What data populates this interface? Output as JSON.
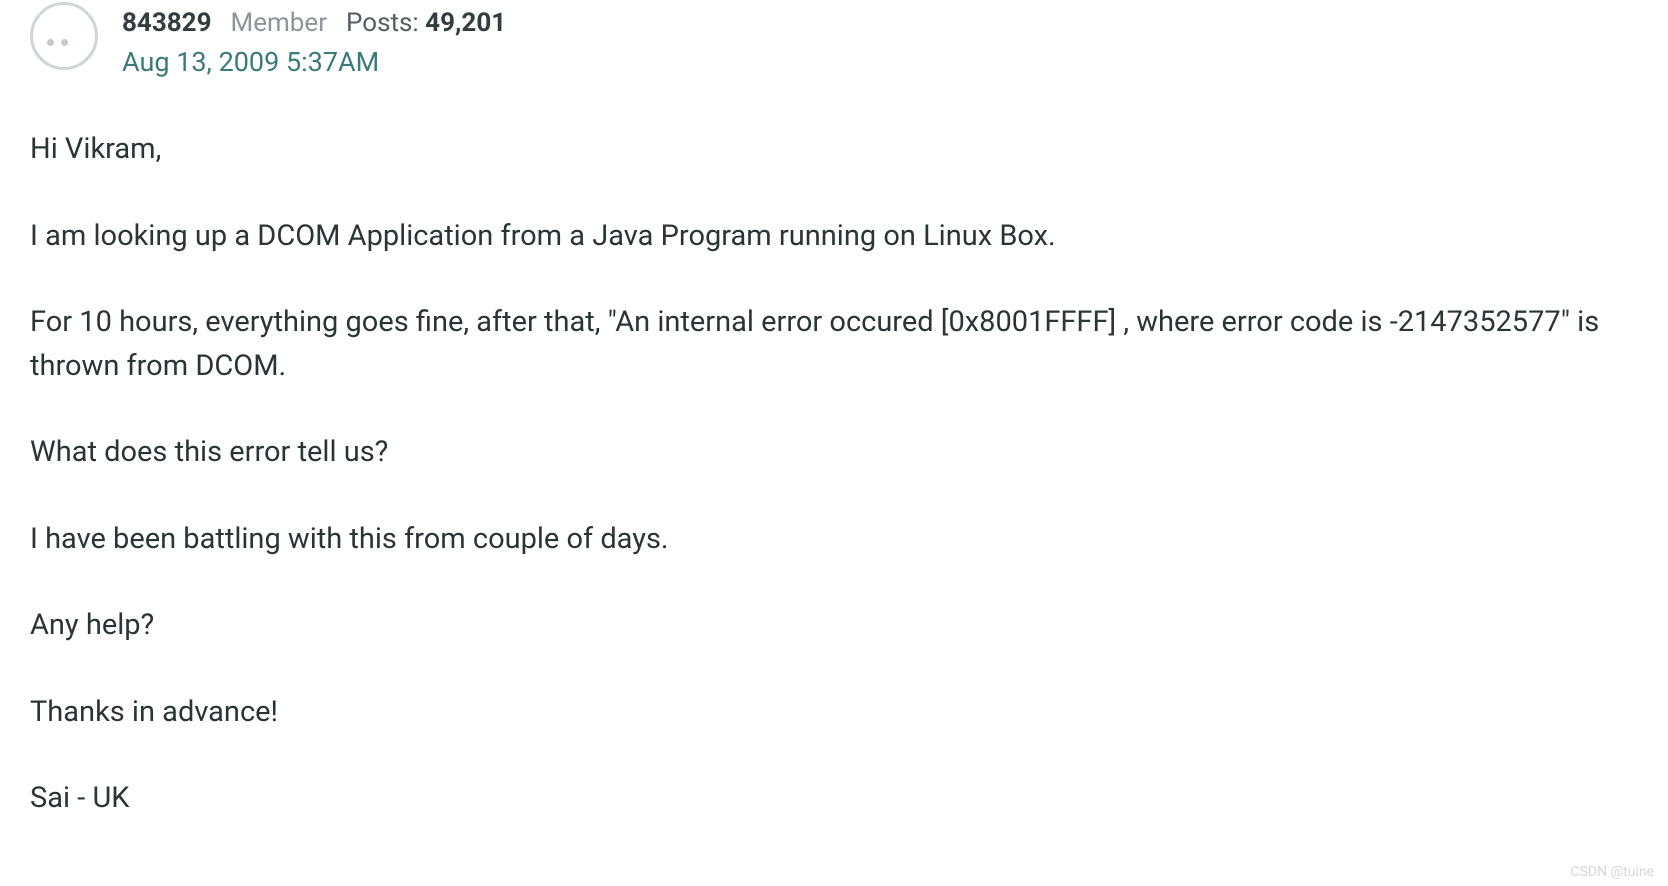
{
  "post": {
    "author": {
      "username": "843829",
      "role": "Member",
      "posts_label": "Posts:",
      "posts_count": "49,201"
    },
    "timestamp": "Aug 13, 2009 5:37AM",
    "body": {
      "p1": "Hi Vikram,",
      "p2": "I am looking up a DCOM Application from a Java Program running on Linux Box.",
      "p3": "For 10 hours, everything goes fine, after that, \"An internal error occured [0x8001FFFF] , where error code is -2147352577\" is thrown from DCOM.",
      "p4": "What does this error tell us?",
      "p5": "I have been battling with this from couple of days.",
      "p6": "Any help?",
      "p7": "Thanks in advance!",
      "p8": "Sai - UK"
    }
  },
  "watermark": "CSDN @tuine"
}
